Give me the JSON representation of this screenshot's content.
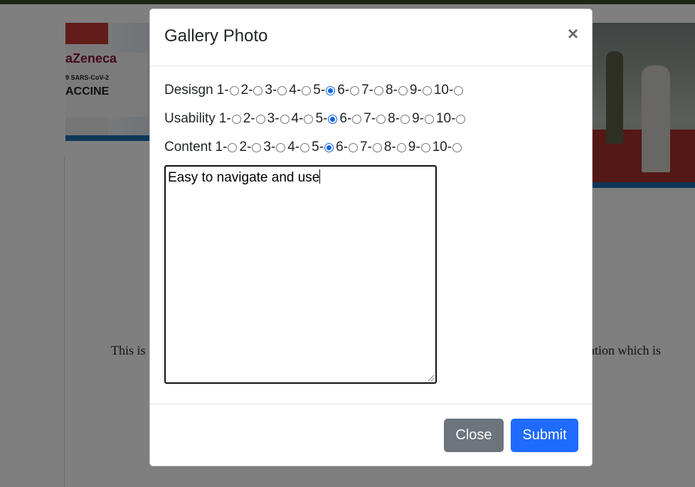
{
  "background": {
    "image1_text": {
      "brand": "aZeneca",
      "line2": "9 SARS-CoV-2",
      "line3": "ACCINE"
    },
    "text_left": "This is",
    "text_right": "ation which is"
  },
  "modal": {
    "title": "Gallery Photo",
    "close_icon": "×",
    "ratings": [
      {
        "label": "Desisgn",
        "options": [
          "1-",
          "2-",
          "3-",
          "4-",
          "5-",
          "6-",
          "7-",
          "8-",
          "9-",
          "10-"
        ],
        "selected": "5"
      },
      {
        "label": "Usability",
        "options": [
          "1-",
          "2-",
          "3-",
          "4-",
          "5-",
          "6-",
          "7-",
          "8-",
          "9-",
          "10-"
        ],
        "selected": "5"
      },
      {
        "label": "Content",
        "options": [
          "1-",
          "2-",
          "3-",
          "4-",
          "5-",
          "6-",
          "7-",
          "8-",
          "9-",
          "10-"
        ],
        "selected": "5"
      }
    ],
    "comment": "Easy to navigate and use",
    "footer": {
      "close_label": "Close",
      "submit_label": "Submit"
    }
  },
  "colors": {
    "accent": "#1f6bff",
    "secondary": "#6c757d",
    "radio_checked": "#0b63e5"
  }
}
